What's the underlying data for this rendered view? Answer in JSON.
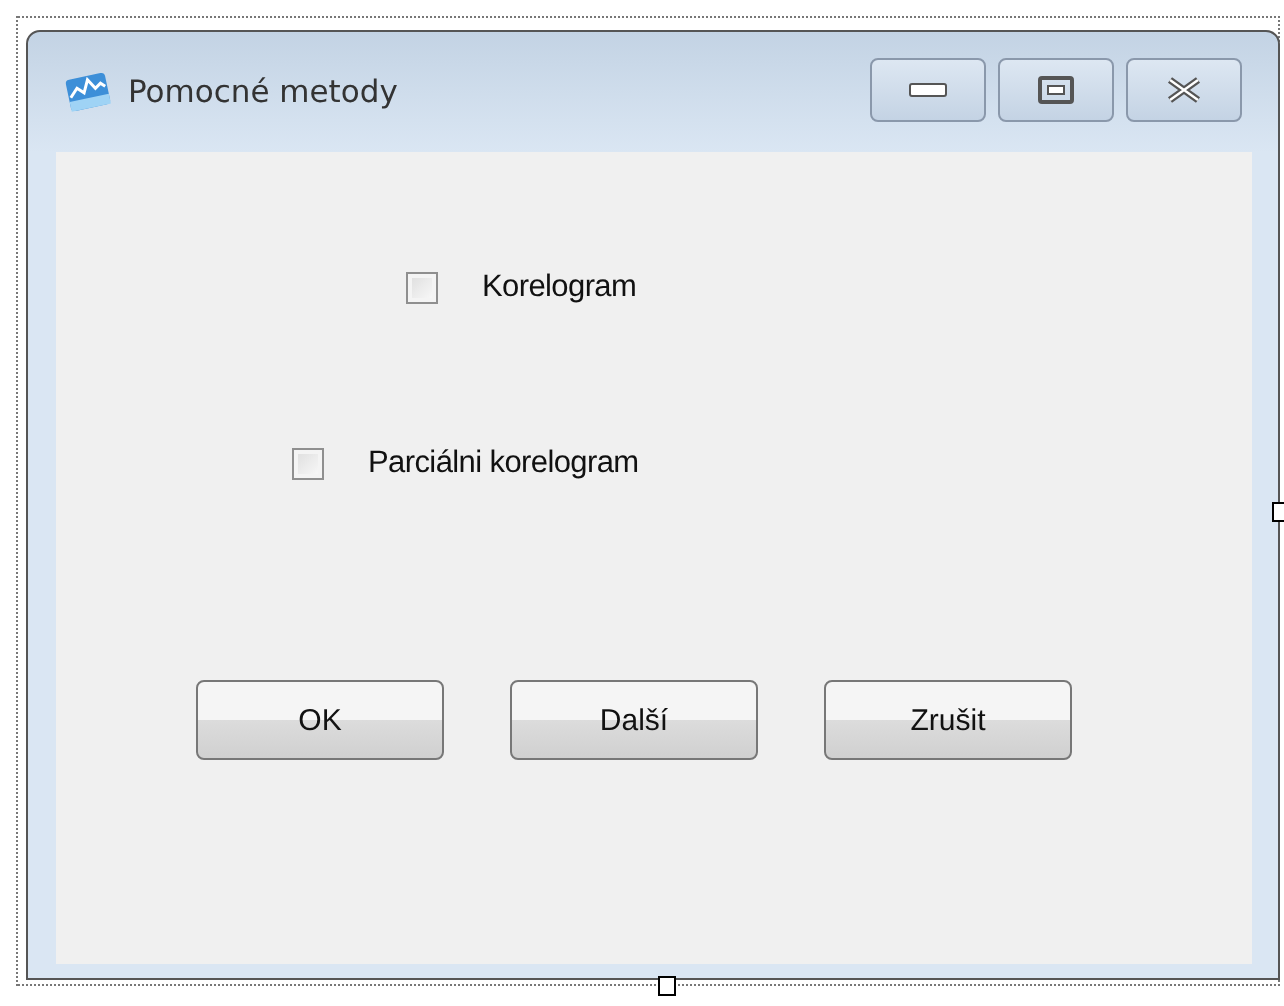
{
  "window": {
    "title": "Pomocné metody"
  },
  "options": [
    {
      "label": "Korelogram",
      "checked": false
    },
    {
      "label": "Parciálni korelogram",
      "checked": false
    }
  ],
  "buttons": [
    "OK",
    "Další",
    "Zrušit"
  ]
}
